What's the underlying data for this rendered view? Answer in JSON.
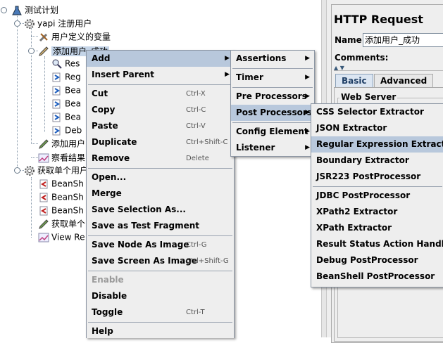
{
  "tree": {
    "root": "测试计划",
    "group1": "yapi 注册用户",
    "user_vars": "用户定义的变量",
    "add_user": "添加用户_成功",
    "c1": "Res",
    "c2": "Reg",
    "c3": "Bea",
    "c4": "Bea",
    "c5": "Bea",
    "c6": "Deb",
    "add_user2": "添加用户",
    "view_results": "察看结果",
    "group2": "获取单个用户",
    "g2c1": "BeanSh",
    "g2c2": "BeanSh",
    "g2c3": "BeanSh",
    "g2c4": "获取单个",
    "g2c5": "View Re"
  },
  "right_panel": {
    "title": "HTTP Request",
    "name_label": "Name:",
    "name_value": "添加用户_成功",
    "comments_label": "Comments:",
    "tab_basic": "Basic",
    "tab_advanced": "Advanced",
    "web_server": "Web Server"
  },
  "menu": {
    "add": "Add",
    "insert_parent": "Insert Parent",
    "cut": "Cut",
    "cut_key": "Ctrl-X",
    "copy": "Copy",
    "copy_key": "Ctrl-C",
    "paste": "Paste",
    "paste_key": "Ctrl-V",
    "duplicate": "Duplicate",
    "duplicate_key": "Ctrl+Shift-C",
    "remove": "Remove",
    "remove_key": "Delete",
    "open": "Open...",
    "merge": "Merge",
    "save_selection": "Save Selection As...",
    "save_fragment": "Save as Test Fragment",
    "save_node_image": "Save Node As Image",
    "save_node_image_key": "Ctrl-G",
    "save_screen_image": "Save Screen As Image",
    "save_screen_image_key": "Ctrl+Shift-G",
    "enable": "Enable",
    "disable": "Disable",
    "toggle": "Toggle",
    "toggle_key": "Ctrl-T",
    "help": "Help"
  },
  "add_submenu": {
    "assertions": "Assertions",
    "timer": "Timer",
    "pre_processors": "Pre Processors",
    "post_processors": "Post Processors",
    "config_element": "Config Element",
    "listener": "Listener"
  },
  "post_submenu": {
    "css": "CSS Selector Extractor",
    "json": "JSON Extractor",
    "regex": "Regular Expression Extractor",
    "boundary": "Boundary Extractor",
    "jsr223": "JSR223 PostProcessor",
    "jdbc": "JDBC PostProcessor",
    "xpath2": "XPath2 Extractor",
    "xpath": "XPath Extractor",
    "result_status": "Result Status Action Handler",
    "debug": "Debug PostProcessor",
    "beanshell": "BeanShell PostProcessor"
  },
  "colors": {
    "highlight": "#b8c8dc",
    "menu_bg": "#eeeeee",
    "selection": "#c5d5e8"
  }
}
